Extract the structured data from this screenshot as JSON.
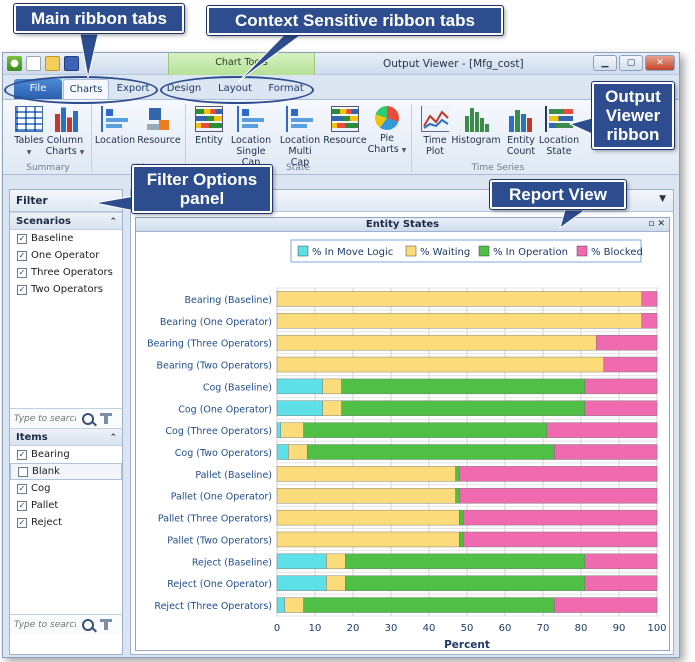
{
  "callouts": {
    "main_tabs": "Main ribbon tabs",
    "context_tabs": "Context Sensitive ribbon tabs",
    "output_ribbon": "Output Viewer ribbon",
    "filter_panel": "Filter Options panel",
    "report_view": "Report View"
  },
  "titlebar": {
    "context_group": "Chart Tools",
    "title": "Output Viewer - [Mfg_cost]"
  },
  "tabs": {
    "file": "File",
    "charts": "Charts",
    "export": "Export",
    "design": "Design",
    "layout": "Layout",
    "format": "Format"
  },
  "ribbon": {
    "tables": "Tables",
    "column_charts": "Column Charts",
    "location": "Location",
    "resource": "Resource",
    "entity": "Entity",
    "location_single_cap": "Location Single Cap",
    "location_multi_cap": "Location Multi Cap",
    "resource_state": "Resource",
    "pie_charts": "Pie Charts",
    "time_plot": "Time Plot",
    "histogram": "Histogram",
    "entity_count": "Entity Count",
    "location_state": "Location State",
    "group_summary": "Summary",
    "group_util": "Uti",
    "group_state": "State",
    "group_time_series": "Time Series"
  },
  "filter": {
    "title": "Filter",
    "scenarios_label": "Scenarios",
    "scenarios": [
      {
        "label": "Baseline",
        "checked": true
      },
      {
        "label": "One Operator",
        "checked": true
      },
      {
        "label": "Three Operators",
        "checked": true
      },
      {
        "label": "Two Operators",
        "checked": true
      }
    ],
    "search_placeholder": "Type to search",
    "items_label": "Items",
    "items": [
      {
        "label": "Bearing",
        "checked": true
      },
      {
        "label": "Blank",
        "checked": false
      },
      {
        "label": "Cog",
        "checked": true
      },
      {
        "label": "Pallet",
        "checked": true
      },
      {
        "label": "Reject",
        "checked": true
      }
    ]
  },
  "colors": {
    "move_logic": "#5ee0e8",
    "waiting": "#fcdc7a",
    "in_operation": "#4fbf45",
    "blocked": "#f06ab0"
  },
  "chart_data": {
    "type": "bar",
    "orientation": "horizontal",
    "stacked": true,
    "title": "Entity States",
    "xlabel": "Percent",
    "xlim": [
      0,
      100
    ],
    "xticks": [
      0,
      10,
      20,
      30,
      40,
      50,
      60,
      70,
      80,
      90,
      100
    ],
    "grid": true,
    "legend_position": "top",
    "categories": [
      "Bearing (Baseline)",
      "Bearing (One Operator)",
      "Bearing (Three Operators)",
      "Bearing (Two Operators)",
      "Cog (Baseline)",
      "Cog (One Operator)",
      "Cog (Three Operators)",
      "Cog (Two Operators)",
      "Pallet (Baseline)",
      "Pallet (One Operator)",
      "Pallet (Three Operators)",
      "Pallet (Two Operators)",
      "Reject (Baseline)",
      "Reject (One Operator)",
      "Reject (Three Operators)"
    ],
    "series": [
      {
        "name": "% In Move Logic",
        "values": [
          0,
          0,
          0,
          0,
          12,
          12,
          1,
          3,
          0,
          0,
          0,
          0,
          13,
          13,
          2
        ]
      },
      {
        "name": "% Waiting",
        "values": [
          96,
          96,
          84,
          86,
          5,
          5,
          6,
          5,
          47,
          47,
          48,
          48,
          5,
          5,
          5
        ]
      },
      {
        "name": "% In Operation",
        "values": [
          0,
          0,
          0,
          0,
          64,
          64,
          64,
          65,
          1,
          1,
          1,
          1,
          63,
          63,
          66
        ]
      },
      {
        "name": "% Blocked",
        "values": [
          4,
          4,
          16,
          14,
          19,
          19,
          29,
          27,
          52,
          52,
          51,
          51,
          19,
          19,
          27
        ]
      }
    ]
  }
}
